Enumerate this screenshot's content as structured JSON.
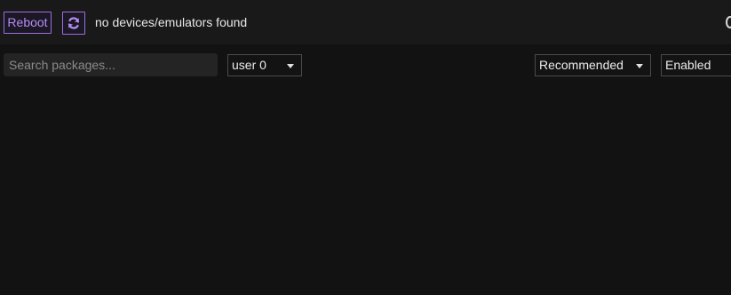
{
  "toolbar": {
    "reboot_label": "Reboot",
    "refresh_icon": "refresh-icon",
    "status_text": "no devices/emulators found"
  },
  "filters": {
    "search_placeholder": "Search packages...",
    "user_value": "user 0",
    "list_value": "Recommended",
    "state_value": "Enabled"
  },
  "colors": {
    "accent": "#9b6fe0",
    "background": "#121212",
    "toolbar_background": "#191919"
  }
}
